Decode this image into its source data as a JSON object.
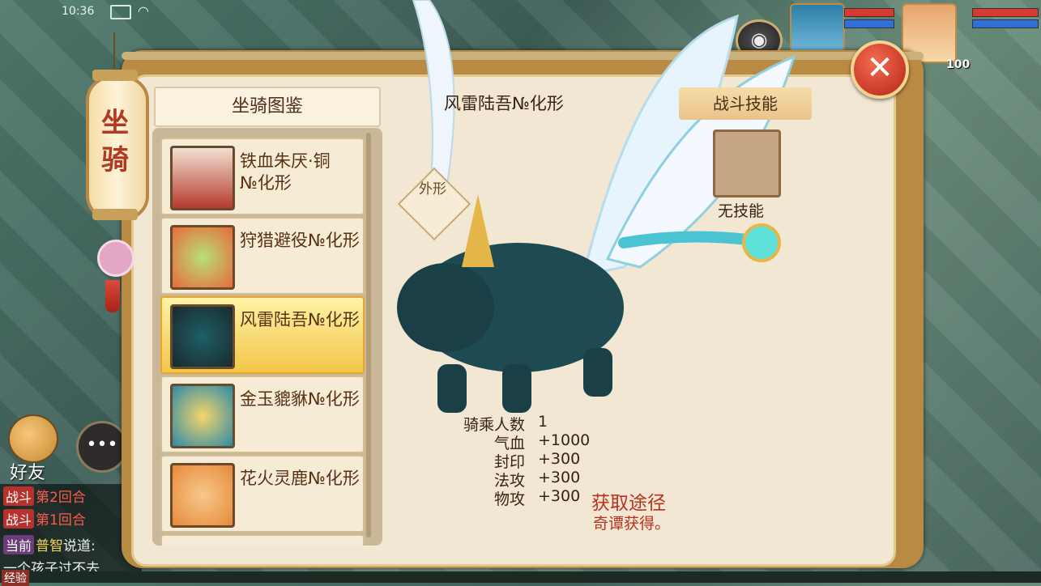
{
  "status_bar": {
    "time": "10:36"
  },
  "top_right": {
    "player_level": "100"
  },
  "side": {
    "lantern_chars": [
      "坐",
      "骑"
    ],
    "friend_label": "好友",
    "chat_lines": [
      {
        "tag": "战斗",
        "text": "第2回合"
      },
      {
        "tag": "战斗",
        "text": "第1回合"
      },
      {
        "tag": "当前",
        "speaker": "普智",
        "text": "说道:"
      },
      {
        "text": "一个孩子过不去"
      }
    ],
    "exp_label": "经验"
  },
  "list": {
    "header": "坐骑图鉴",
    "items": [
      {
        "label": "铁血朱厌·铜№化形",
        "selected": false
      },
      {
        "label": "狩猎避役№化形",
        "selected": false
      },
      {
        "label": "风雷陆吾№化形",
        "selected": true
      },
      {
        "label": "金玉貔貅№化形",
        "selected": false
      },
      {
        "label": "花火灵鹿№化形",
        "selected": false
      }
    ]
  },
  "detail": {
    "mount_name": "风雷陆吾№化形",
    "appearance_label": "外形",
    "skills_header": "战斗技能",
    "no_skill": "无技能",
    "stats": [
      {
        "label": "骑乘人数",
        "value": "1"
      },
      {
        "label": "气血",
        "value": "+1000"
      },
      {
        "label": "封印",
        "value": "+300"
      },
      {
        "label": "法攻",
        "value": "+300"
      },
      {
        "label": "物攻",
        "value": "+300"
      }
    ],
    "acquire_title": "获取途径",
    "acquire_desc": "奇谭获得。"
  },
  "colors": {
    "accent_red": "#b8321f",
    "selected_gold": "#f2c548",
    "panel_bg": "#f1e7d3"
  },
  "icons": {
    "close": "close-icon",
    "camera": "camera-icon",
    "chat": "chat-bubble-icon"
  }
}
